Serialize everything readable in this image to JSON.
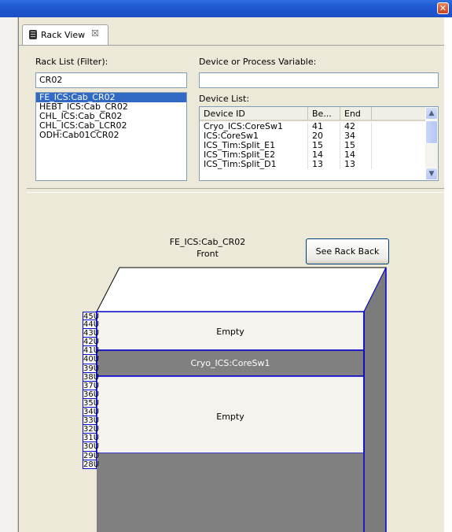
{
  "window": {
    "close_glyph": "✕"
  },
  "tab": {
    "label": "Rack View",
    "close_glyph": "☒"
  },
  "rack_list": {
    "label": "Rack List (Filter):",
    "filter_value": "CR02",
    "items": [
      "FE_ICS:Cab_CR02",
      "HEBT_ICS:Cab_CR02",
      "CHL_ICS:Cab_CR02",
      "CHL_ICS:Cab_LCR02",
      "ODH:Cab01CCR02"
    ],
    "selected_index": 0
  },
  "device_search": {
    "label": "Device or Process Variable:",
    "value": ""
  },
  "device_list": {
    "label": "Device List:",
    "columns": [
      "Device ID",
      "Be...",
      "End"
    ],
    "rows": [
      [
        "Cryo_ICS:CoreSw1",
        "41",
        "42"
      ],
      [
        "ICS:CoreSw1",
        "20",
        "34"
      ],
      [
        "ICS_Tim:Split_E1",
        "15",
        "15"
      ],
      [
        "ICS_Tim:Split_E2",
        "14",
        "14"
      ],
      [
        "ICS_Tim:Split_D1",
        "13",
        "13"
      ]
    ]
  },
  "rack": {
    "name": "FE_ICS:Cab_CR02",
    "side": "Front",
    "toggle_button": "See Rack Back",
    "units": [
      "45U",
      "44U",
      "43U",
      "42U",
      "41U",
      "40U",
      "39U",
      "38U",
      "37U",
      "36U",
      "35U",
      "34U",
      "33U",
      "32U",
      "31U",
      "30U",
      "29U",
      "28U"
    ],
    "slots": [
      {
        "label": "Empty"
      },
      {
        "label": "Cryo_ICS:CoreSw1"
      },
      {
        "label": "Empty"
      }
    ]
  },
  "colors": {
    "occupied": "#808080",
    "empty": "#f4f3ee",
    "border": "#0000cc",
    "title_bar": "#1d56cf"
  }
}
